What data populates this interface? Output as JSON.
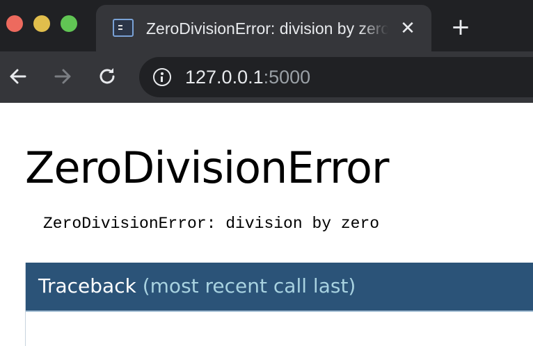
{
  "window_controls": {
    "close": "close",
    "minimize": "minimize",
    "zoom": "zoom"
  },
  "tab": {
    "title": "ZeroDivisionError: division by zero",
    "favicon": "terminal-icon",
    "close_glyph": "✕"
  },
  "new_tab_glyph": "+",
  "toolbar": {
    "back_icon": "arrow-left-icon",
    "forward_icon": "arrow-right-icon",
    "reload_icon": "reload-icon"
  },
  "address_bar": {
    "icon": "info-icon",
    "host": "127.0.0.1",
    "port": ":5000"
  },
  "page": {
    "title": "ZeroDivisionError",
    "message": "ZeroDivisionError: division by zero",
    "traceback": {
      "label": "Traceback",
      "sub_label": "(most recent call last)"
    }
  },
  "colors": {
    "chrome_dark": "#202124",
    "chrome_tab": "#35363a",
    "traceback_header": "#2b5378",
    "traceback_sub": "#a8d2e0"
  }
}
